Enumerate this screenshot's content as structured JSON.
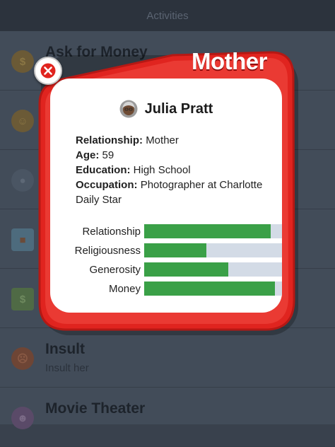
{
  "background": {
    "header_title": "Activities",
    "rows": [
      {
        "title": "Ask for Money",
        "subtitle": "",
        "icon": "money-bag-icon"
      },
      {
        "title": "",
        "subtitle": "",
        "icon": "face-emoji-icon"
      },
      {
        "title": "",
        "subtitle": "",
        "icon": "people-icon"
      },
      {
        "title": "",
        "subtitle": "",
        "icon": "gift-icon"
      },
      {
        "title": "",
        "subtitle": "",
        "icon": "cash-icon"
      },
      {
        "title": "Insult",
        "subtitle": "Insult her",
        "icon": "angry-face-icon"
      },
      {
        "title": "Movie Theater",
        "subtitle": "",
        "icon": "theater-masks-icon"
      }
    ]
  },
  "modal": {
    "title": "Mother",
    "close_icon": "close-icon",
    "person": {
      "name": "Julia Pratt",
      "avatar_icon": "grandmother-avatar-icon"
    },
    "details": [
      {
        "label": "Relationship:",
        "value": "Mother"
      },
      {
        "label": "Age:",
        "value": "59"
      },
      {
        "label": "Education:",
        "value": "High School"
      },
      {
        "label": "Occupation:",
        "value": "Photographer at Charlotte Daily Star"
      }
    ],
    "stats": [
      {
        "label": "Relationship",
        "value": 0.92
      },
      {
        "label": "Religiousness",
        "value": 0.45
      },
      {
        "label": "Generosity",
        "value": 0.61
      },
      {
        "label": "Money",
        "value": 0.95
      }
    ]
  },
  "colors": {
    "modal_red": "#e0241f",
    "bar_fill": "#3aa047",
    "bar_track": "#d3dbe6"
  }
}
